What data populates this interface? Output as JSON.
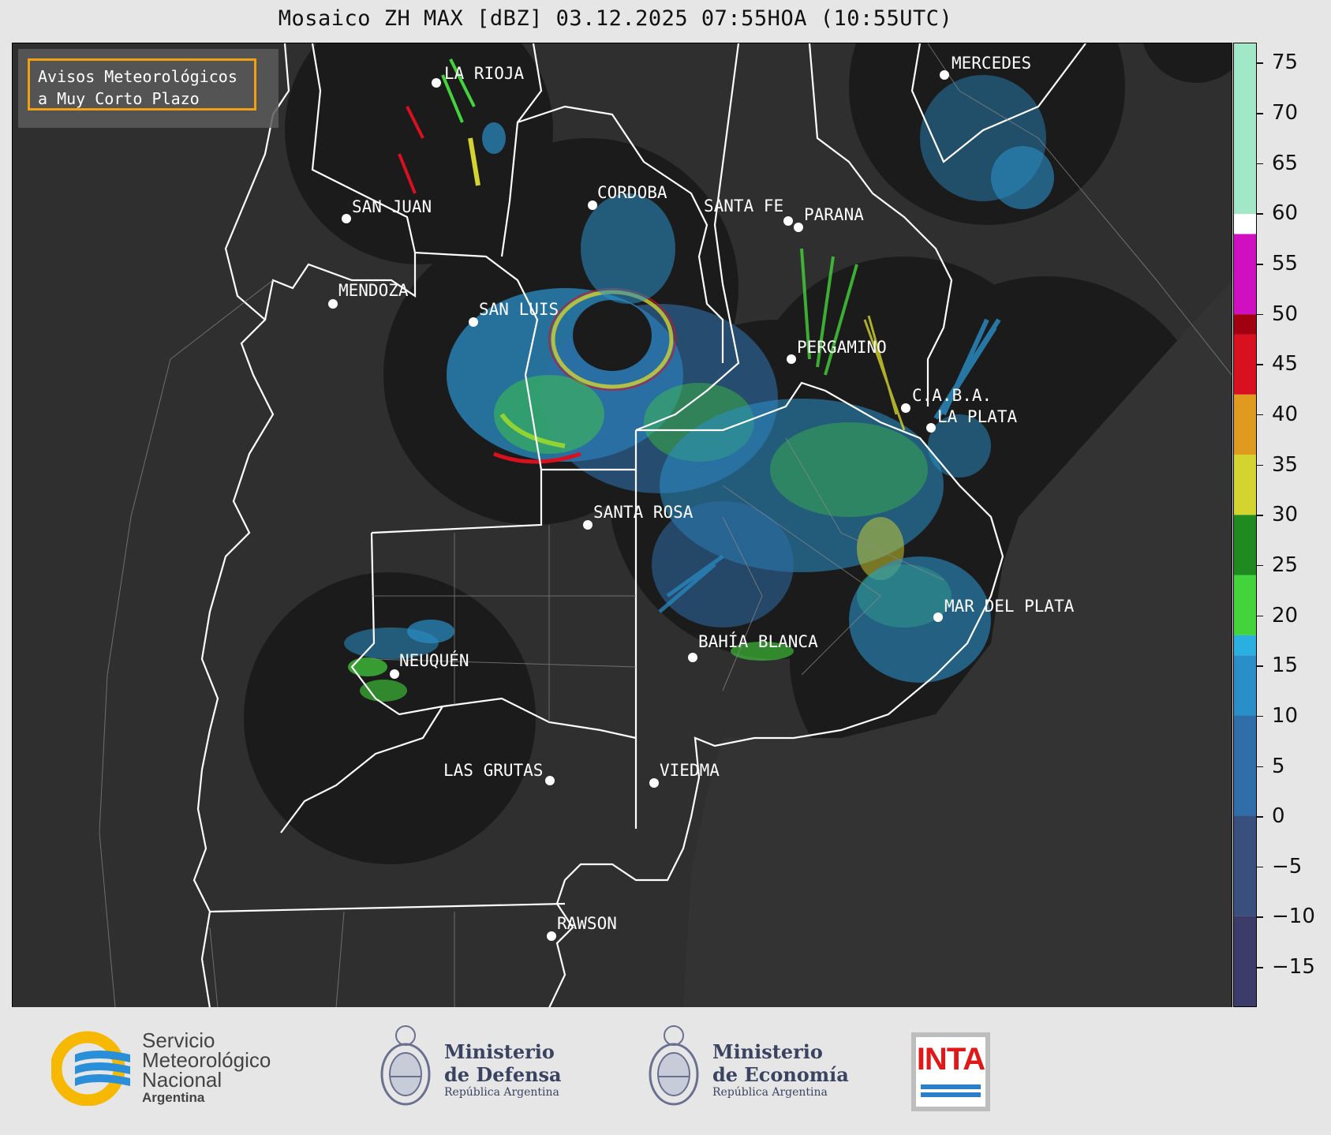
{
  "title": "Mosaico ZH MAX [dBZ] 03.12.2025 07:55HOA (10:55UTC)",
  "notice": {
    "line1": "Avisos Meteorológicos",
    "line2": "a Muy Corto Plazo"
  },
  "colors": {
    "map_background": "#2f2f2f",
    "radar_coverage": "#1b1b1b",
    "boundary": "#ffffff",
    "notice_border": "#f0a010"
  },
  "cities": [
    {
      "name": "LA RIOJA"
    },
    {
      "name": "MERCEDES"
    },
    {
      "name": "CORDOBA"
    },
    {
      "name": "SAN JUAN"
    },
    {
      "name": "SANTA FE"
    },
    {
      "name": "PARANA"
    },
    {
      "name": "MENDOZA"
    },
    {
      "name": "SAN LUIS"
    },
    {
      "name": "PERGAMINO"
    },
    {
      "name": "C.A.B.A."
    },
    {
      "name": "LA PLATA"
    },
    {
      "name": "SANTA ROSA"
    },
    {
      "name": "MAR DEL PLATA"
    },
    {
      "name": "BAHÍA BLANCA"
    },
    {
      "name": "NEUQUÉN"
    },
    {
      "name": "LAS GRUTAS"
    },
    {
      "name": "VIEDMA"
    },
    {
      "name": "RAWSON"
    }
  ],
  "colorbar": {
    "unit": "dBZ",
    "range": [
      -19,
      77
    ],
    "ticks": [
      "75",
      "70",
      "65",
      "60",
      "55",
      "50",
      "45",
      "40",
      "35",
      "30",
      "25",
      "20",
      "15",
      "10",
      "5",
      "0",
      "−5",
      "−10",
      "−15"
    ],
    "scale_colors": [
      {
        "from": -19,
        "to": -10,
        "color": "#3c3c6a"
      },
      {
        "from": -10,
        "to": 0,
        "color": "#39507e"
      },
      {
        "from": 0,
        "to": 10,
        "color": "#2f6ea8"
      },
      {
        "from": 10,
        "to": 16,
        "color": "#2a8fc8"
      },
      {
        "from": 16,
        "to": 18,
        "color": "#2ab0e0"
      },
      {
        "from": 18,
        "to": 24,
        "color": "#43d33a"
      },
      {
        "from": 24,
        "to": 30,
        "color": "#1f8a20"
      },
      {
        "from": 30,
        "to": 36,
        "color": "#d4d430"
      },
      {
        "from": 36,
        "to": 42,
        "color": "#e09a20"
      },
      {
        "from": 42,
        "to": 48,
        "color": "#d81020"
      },
      {
        "from": 48,
        "to": 50,
        "color": "#a00010"
      },
      {
        "from": 50,
        "to": 58,
        "color": "#d010c0"
      },
      {
        "from": 58,
        "to": 60,
        "color": "#ffffff"
      },
      {
        "from": 60,
        "to": 77,
        "color": "#a0e8c8"
      }
    ]
  },
  "footer": {
    "smn": {
      "line1": "Servicio",
      "line2": "Meteorológico",
      "line3": "Nacional",
      "line4": "Argentina"
    },
    "defensa": {
      "line1": "Ministerio",
      "line2": "de Defensa",
      "line3": "República Argentina"
    },
    "economia": {
      "line1": "Ministerio",
      "line2": "de Economía",
      "line3": "República Argentina"
    },
    "inta": {
      "text": "INTA"
    }
  }
}
